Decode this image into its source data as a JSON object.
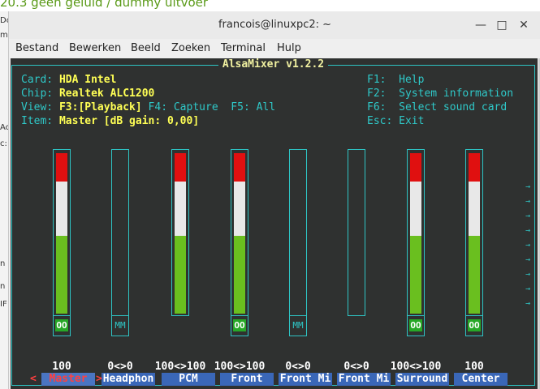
{
  "background": {
    "heading": "20.3 geen geluid / dummy uitvoer",
    "fragments": [
      "Do",
      "mi",
      "Ac",
      "c:",
      "n",
      "n",
      "IF"
    ]
  },
  "window": {
    "title": "francois@linuxpc2: ~",
    "controls": {
      "minimize": "—",
      "maximize": "□",
      "close": "✕"
    }
  },
  "menu": [
    "Bestand",
    "Bewerken",
    "Beeld",
    "Zoeken",
    "Terminal",
    "Hulp"
  ],
  "mixer": {
    "title": "AlsaMixer v1.2.2",
    "card_label": "Card:",
    "card": "HDA Intel",
    "chip_label": "Chip:",
    "chip": "Realtek ALC1200",
    "view_label": "View:",
    "view_playback": "F3:[Playback]",
    "view_capture": "F4: Capture",
    "view_all": "F5: All",
    "item_label": "Item:",
    "item": "Master [dB gain: 0,00]",
    "help": [
      {
        "key": "F1:",
        "action": "Help"
      },
      {
        "key": "F2:",
        "action": "System information"
      },
      {
        "key": "F6:",
        "action": "Select sound card"
      },
      {
        "key": "Esc:",
        "action": "Exit"
      }
    ],
    "scroll_arrows": "→\n→\n→\n→\n→\n→\n→\n→\n→",
    "selected_left": "<",
    "selected_right": ">",
    "channels": [
      {
        "name": "Master",
        "value": "100",
        "level": 1.0,
        "has_bar": true,
        "mute": "OO",
        "muted_state": "on"
      },
      {
        "name": "Headphon",
        "value": "0<>0",
        "level": 0.0,
        "has_bar": false,
        "mute": "MM",
        "muted_state": "off"
      },
      {
        "name": "PCM",
        "value": "100<>100",
        "level": 1.0,
        "has_bar": true,
        "mute": "",
        "muted_state": "none"
      },
      {
        "name": "Front",
        "value": "100<>100",
        "level": 1.0,
        "has_bar": true,
        "mute": "OO",
        "muted_state": "on"
      },
      {
        "name": "Front Mi",
        "value": "0<>0",
        "level": 0.0,
        "has_bar": false,
        "mute": "MM",
        "muted_state": "off"
      },
      {
        "name": "Front Mi",
        "value": "0<>0",
        "level": 0.0,
        "has_bar": false,
        "mute": "",
        "muted_state": "none"
      },
      {
        "name": "Surround",
        "value": "100<>100",
        "level": 1.0,
        "has_bar": true,
        "mute": "OO",
        "muted_state": "on"
      },
      {
        "name": "Center",
        "value": "100",
        "level": 1.0,
        "has_bar": true,
        "mute": "OO",
        "muted_state": "on"
      }
    ],
    "colors": {
      "red": "#e01010",
      "white": "#e8e8e8",
      "green": "#6abf1f",
      "cyan": "#2ec4c4",
      "yellow": "#ffff55"
    }
  }
}
